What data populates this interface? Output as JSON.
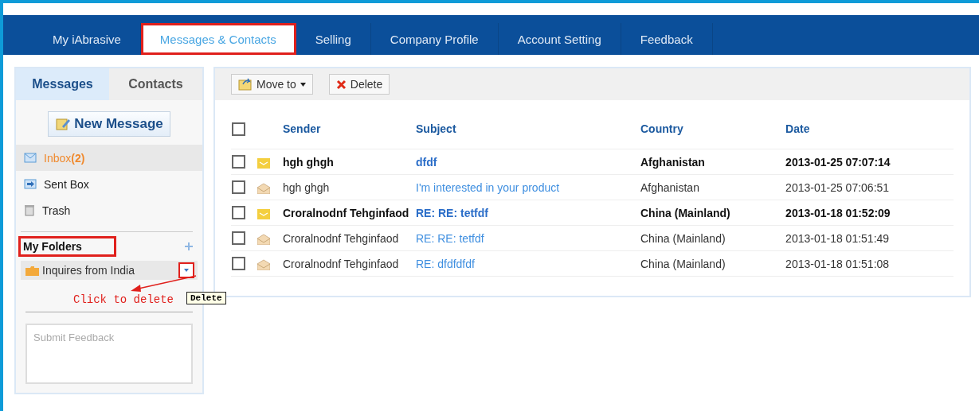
{
  "nav": {
    "tabs": [
      {
        "label": "My iAbrasive",
        "selected": false,
        "highlighted": false
      },
      {
        "label": "Messages & Contacts",
        "selected": true,
        "highlighted": true
      },
      {
        "label": "Selling",
        "selected": false,
        "highlighted": false
      },
      {
        "label": "Company Profile",
        "selected": false,
        "highlighted": false
      },
      {
        "label": "Account Setting",
        "selected": false,
        "highlighted": false
      },
      {
        "label": "Feedback",
        "selected": false,
        "highlighted": false
      }
    ]
  },
  "sidebar": {
    "tabs": [
      {
        "label": "Messages",
        "selected": true
      },
      {
        "label": "Contacts",
        "selected": false
      }
    ],
    "new_message_button": "New Message",
    "mailboxes": [
      {
        "kind": "inbox",
        "label": "Inbox",
        "count": "(2)",
        "selected": true
      },
      {
        "kind": "sent",
        "label": "Sent Box",
        "selected": false
      },
      {
        "kind": "trash",
        "label": "Trash",
        "selected": false
      }
    ],
    "folders_heading": {
      "label": "My Folders",
      "highlighted": true
    },
    "folders": [
      {
        "label": "Inquires from India",
        "menu_highlighted": true
      }
    ],
    "annotation": "Click to delete",
    "tooltip": "Delete",
    "feedback": {
      "placeholder": "Submit Feedback"
    }
  },
  "toolbar": {
    "move_button": "Move to",
    "delete_button": "Delete"
  },
  "table": {
    "select_all_checked": false,
    "columns": [
      "Sender",
      "Subject",
      "Country",
      "Date"
    ],
    "rows": [
      {
        "checked": false,
        "unread": true,
        "sender": "hgh ghgh",
        "subject": "dfdf",
        "country": "Afghanistan",
        "date": "2013-01-25 07:07:14"
      },
      {
        "checked": false,
        "unread": false,
        "sender": "hgh ghgh",
        "subject": "I'm interested in your product",
        "country": "Afghanistan",
        "date": "2013-01-25 07:06:51"
      },
      {
        "checked": false,
        "unread": true,
        "sender": "Croralnodnf Tehginfaod",
        "subject": "RE: RE: tetfdf",
        "country": "China (Mainland)",
        "date": "2013-01-18 01:52:09"
      },
      {
        "checked": false,
        "unread": false,
        "sender": "Croralnodnf Tehginfaod",
        "subject": "RE: RE: tetfdf",
        "country": "China (Mainland)",
        "date": "2013-01-18 01:51:49"
      },
      {
        "checked": false,
        "unread": false,
        "sender": "Croralnodnf Tehginfaod",
        "subject": "RE: dfdfdfdf",
        "country": "China (Mainland)",
        "date": "2013-01-18 01:51:08"
      }
    ]
  }
}
